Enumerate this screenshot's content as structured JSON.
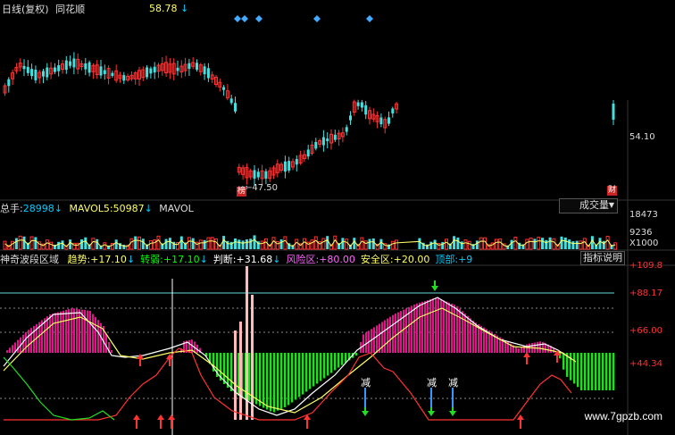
{
  "price_panel": {
    "title": "日线(复权)",
    "source": "同花顺",
    "price_hint": "58.78",
    "price_hint_arrow": "↓",
    "right_label": "54.10",
    "low_marker": "47.50",
    "low_marker_prefix": "←",
    "mark_tag": "榜",
    "fin_tag": "财"
  },
  "volume_panel": {
    "total_label": "总手:",
    "total_value": "28998",
    "mavol5_label": "MAVOL5:",
    "mavol5_value": "50987",
    "mavol_label": "MAVOL",
    "down_arrow": "↓",
    "select_value": "成交量",
    "select_caret": "▼",
    "axis_labels": [
      "18473",
      "9236",
      "X1000"
    ]
  },
  "indicator_panel": {
    "name": "神奇波段区域",
    "items": [
      {
        "label": "趋势:",
        "value": "+17.10",
        "arrow": "↓",
        "color": "#ffff66"
      },
      {
        "label": "转弱:",
        "value": "+17.10",
        "arrow": "↓",
        "color": "#00ff00"
      },
      {
        "label": "判断:",
        "value": "+31.68",
        "arrow": "↓",
        "color": "#ffffff"
      },
      {
        "label": "风险区:",
        "value": "+80.00",
        "arrow": "",
        "color": "#ff66ff"
      },
      {
        "label": "安全区:",
        "value": "+20.00",
        "arrow": "",
        "color": "#ffff66"
      },
      {
        "label": "顶部:",
        "value": "+9",
        "arrow": "",
        "color": "#00ccff"
      }
    ],
    "help_button": "指标说明",
    "axis_labels": [
      "+109.8",
      "+88.17",
      "+66.00",
      "+44.34"
    ],
    "reduce_label": "减"
  },
  "watermark": "www.7gpzb.com",
  "colors": {
    "up": "#ff3333",
    "down": "#44e0e0",
    "risk": "#e0148c",
    "safe": "#22dd22",
    "trend": "#ffff66",
    "cyan_line": "#66dddd"
  }
}
